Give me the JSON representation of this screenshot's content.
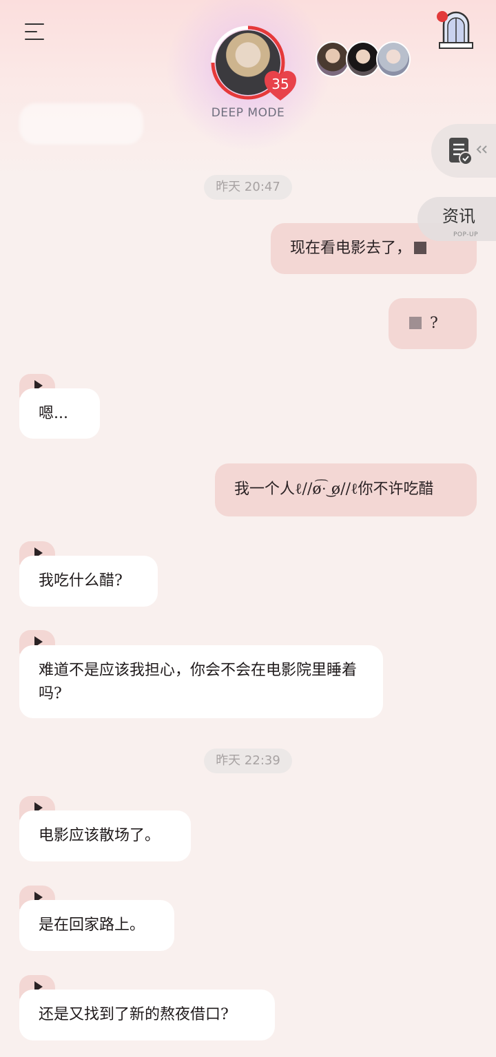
{
  "header": {
    "mode_label": "DEEP MODE",
    "affinity_level": "35"
  },
  "side_panel": {
    "news_label": "资讯",
    "news_sub": "POP-UP"
  },
  "timestamps": [
    "昨天 20:47",
    "昨天 22:39"
  ],
  "messages": [
    {
      "from": "me",
      "text": "现在看电影去了，"
    },
    {
      "from": "me",
      "text": "?"
    },
    {
      "from": "bot",
      "text": "嗯..."
    },
    {
      "from": "me",
      "text": "我一个人ℓ//ø͡·͜ ø//ℓ你不许吃醋"
    },
    {
      "from": "bot",
      "text": "我吃什么醋?"
    },
    {
      "from": "bot",
      "text": "难道不是应该我担心，你会不会在电影院里睡着吗?"
    },
    {
      "from": "bot",
      "text": "电影应该散场了。"
    },
    {
      "from": "bot",
      "text": "是在回家路上。"
    },
    {
      "from": "bot",
      "text": "还是又找到了新的熬夜借口?"
    }
  ],
  "colors": {
    "accent": "#e23a3a",
    "user_bubble": "#f3d7d4",
    "bot_bubble": "#ffffff",
    "background": "#f9f0ee"
  }
}
